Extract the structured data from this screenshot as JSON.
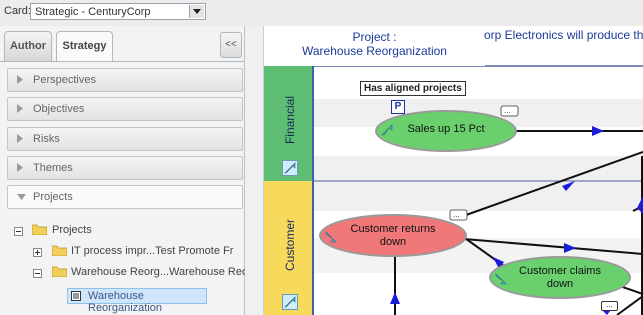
{
  "card": {
    "label": "Card:",
    "value": "Strategic - CenturyCorp"
  },
  "tabs": [
    {
      "label": "Author"
    },
    {
      "label": "Strategy"
    }
  ],
  "collapse_label": "<<",
  "accordion": [
    {
      "label": "Perspectives"
    },
    {
      "label": "Objectives"
    },
    {
      "label": "Risks"
    },
    {
      "label": "Themes"
    },
    {
      "label": "Projects"
    }
  ],
  "tree": {
    "root": "Projects",
    "items": [
      {
        "label": "IT process impr...Test Promote Fr"
      },
      {
        "label": "Warehouse Reorg...Warehouse Reorg"
      }
    ],
    "selected": "Warehouse Reorganization"
  },
  "map": {
    "title_line1": "Project :",
    "title_line2": "Warehouse Reorganization",
    "marquee": "orp Electronics will produce th",
    "lanes": [
      {
        "label": "Financial",
        "color": "#5dbd73"
      },
      {
        "label": "Customer",
        "color": "#f7d95c"
      }
    ],
    "aligned_label": "Has aligned projects",
    "aligned_badge": "P",
    "nodes": [
      {
        "label_line1": "Sales up 15 Pct",
        "label_line2": "",
        "color": "#6ad06e"
      },
      {
        "label_line1": "Customer returns",
        "label_line2": "down",
        "color": "#f07878"
      },
      {
        "label_line1": "Customer claims",
        "label_line2": "down",
        "color": "#6ad06e"
      }
    ]
  }
}
